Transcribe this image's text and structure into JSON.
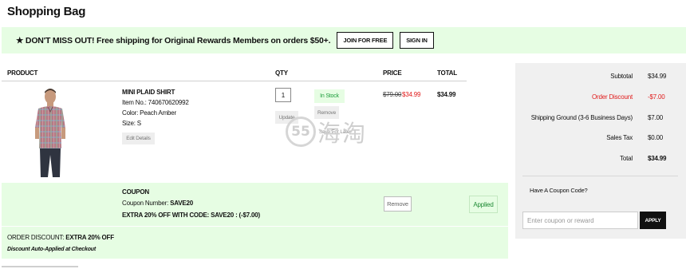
{
  "page": {
    "title": "Shopping Bag"
  },
  "promo": {
    "text": "★ DON'T MISS OUT! Free shipping for Original Rewards Members on orders $50+.",
    "join_label": "JOIN FOR FREE",
    "signin_label": "SIGN IN"
  },
  "table_headers": {
    "product": "PRODUCT",
    "qty": "QTY",
    "price": "PRICE",
    "total": "TOTAL"
  },
  "item": {
    "name": "MINI PLAID SHIRT",
    "item_no": "Item No.: 740670620992",
    "color": "Color: Peach Amber",
    "size": "Size: S",
    "edit_label": "Edit Details",
    "qty": "1",
    "update_label": "Update",
    "stock": "In Stock",
    "remove_label": "Remove",
    "save_later_label": "Save For Later",
    "price_original": "$79.00",
    "price_sale": "$34.99",
    "total": "$34.99"
  },
  "watermark": {
    "circle": "55",
    "text": "海淘"
  },
  "coupon": {
    "title": "COUPON",
    "number_label": "Coupon Number: ",
    "number_value": "SAVE20",
    "extra": "EXTRA 20% OFF WITH CODE: SAVE20 : (-$7.00)",
    "remove_label": "Remove",
    "applied_label": "Applied"
  },
  "order_discount": {
    "label": "ORDER DISCOUNT: ",
    "value": "EXTRA 20% OFF",
    "note": "Discount Auto-Applied at Checkout"
  },
  "summary": {
    "subtotal_label": "Subtotal",
    "subtotal_value": "$34.99",
    "discount_label": "Order Discount",
    "discount_value": "-$7.00",
    "shipping_label": "Shipping Ground (3-6 Business Days)",
    "shipping_value": "$7.00",
    "tax_label": "Sales Tax",
    "tax_value": "$0.00",
    "total_label": "Total",
    "total_value": "$34.99",
    "coupon_question": "Have A Coupon Code?",
    "coupon_placeholder": "Enter coupon or reward",
    "apply_label": "APPLY"
  },
  "colors": {
    "promo_bg": "#e6fde3",
    "sale_red": "#e01b1b",
    "summary_bg": "#f0f0f0",
    "in_stock_green": "#1e9d3c"
  },
  "icons": {
    "star": "star-icon"
  }
}
